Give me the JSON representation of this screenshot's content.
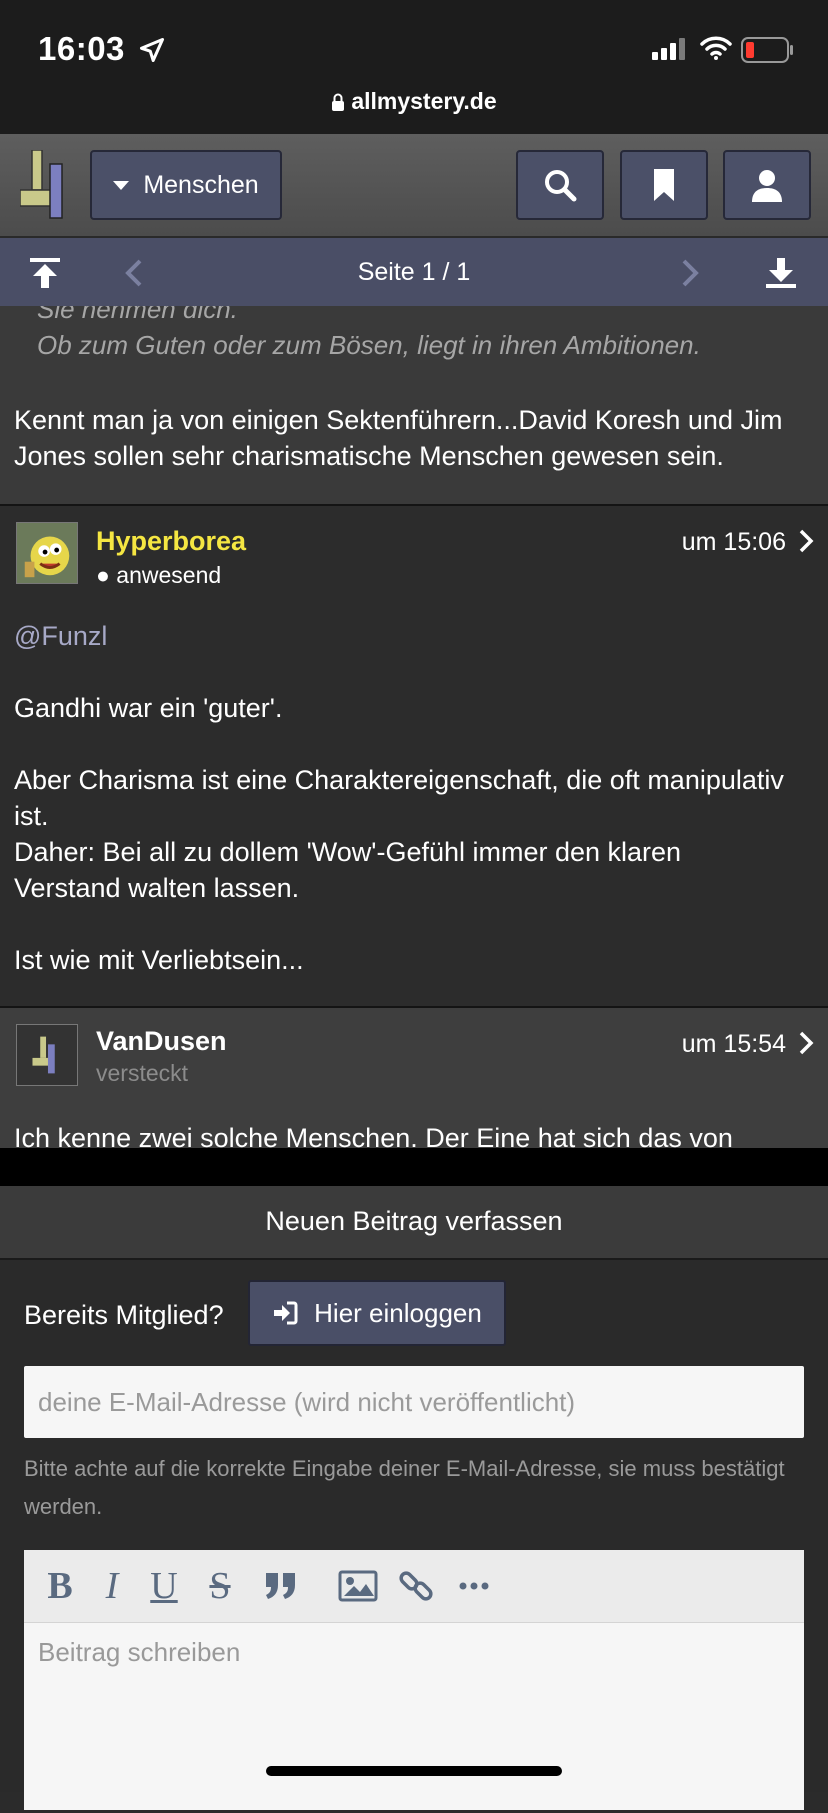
{
  "status_bar": {
    "time": "16:03",
    "url": "allmystery.de"
  },
  "header": {
    "menu_label": "Menschen"
  },
  "pagination": {
    "label": "Seite 1 / 1"
  },
  "post_partial": {
    "quote_lines": [
      "Sie nehmen dich.",
      "Ob zum Guten oder zum Bösen, liegt in ihren Ambitionen."
    ],
    "body": [
      "Kennt man ja von einigen Sektenführern...David Koresh und Jim",
      "Jones sollen sehr charismatische Menschen gewesen sein."
    ]
  },
  "post_hyperborea": {
    "username": "Hyperborea",
    "status": "anwesend",
    "time": "um 15:06",
    "mention": "@Funzl",
    "lines": [
      "Gandhi war ein 'guter'.",
      "Aber Charisma ist eine Charaktereigenschaft, die oft manipulativ",
      "ist.",
      "Daher: Bei all zu dollem 'Wow'-Gefühl immer den klaren",
      "Verstand walten lassen.",
      "Ist wie mit Verliebtsein..."
    ]
  },
  "post_vandusen": {
    "username": "VanDusen",
    "status": "versteckt",
    "time": "um 15:54",
    "first_line": "Ich kenne zwei solche Menschen. Der Eine hat sich das von"
  },
  "compose": {
    "title": "Neuen Beitrag verfassen",
    "member_label": "Bereits Mitglied?",
    "login_label": "Hier einloggen",
    "email_placeholder": "deine E-Mail-Adresse (wird nicht veröffentlicht)",
    "hint": "Bitte achte auf die korrekte Eingabe deiner E-Mail-Adresse, sie muss bestätigt werden.",
    "editor_placeholder": "Beitrag schreiben",
    "toolbar": {
      "bold": "B",
      "italic": "I",
      "underline": "U",
      "strike": "S"
    }
  },
  "colors": {
    "accent_user": "#f5e642",
    "button_bg": "#4b5068",
    "pagebar_bg": "#4a4e66"
  }
}
